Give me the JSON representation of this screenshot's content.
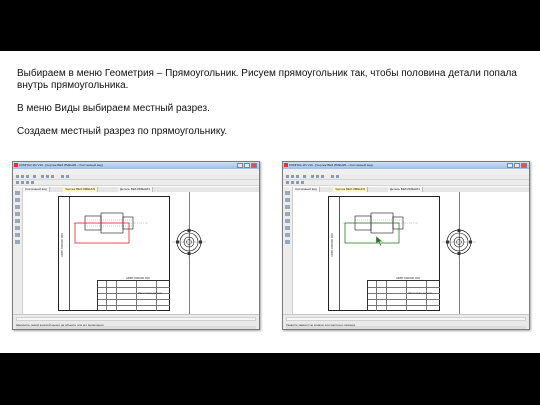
{
  "paragraphs": [
    "Выбираем в меню Геометрия – Прямоугольник. Рисуем прямоугольник так, чтобы половина детали попала внутрь прямоугольника.",
    "В меню Виды выбираем местный разрез.",
    "Создаем местный разрез по прямоугольнику."
  ],
  "screenshots": [
    {
      "window_title": "КОМПАС-3D V10 - [Чертеж БЕЗ ИМЕНИ1 ->Системный вид]",
      "menu": [
        "Файл",
        "Редактор",
        "Выделить",
        "Вид",
        "Вставка",
        "Инструменты",
        "Спецификация",
        "Сервис",
        "Окно",
        "Справка"
      ],
      "tabs": [
        "Системный вид",
        "Чертеж БЕЗ ИМЕНИ1",
        "Деталь БЕЗ ИМЕНИ1"
      ],
      "active_tab": 1,
      "drawing_code": "АБВГ.000000.000",
      "part_name": "Заготовка детали",
      "status": "Щелкните левой кнопкой мыши на объекте для его выделения",
      "highlight_color": "#e0262e"
    },
    {
      "window_title": "КОМПАС-3D V10 - [Чертеж БЕЗ ИМЕНИ1 ->Системный вид]",
      "menu": [
        "Файл",
        "Редактор",
        "Выделить",
        "Вид",
        "Вставка",
        "Инструменты",
        "Спецификация",
        "Сервис",
        "Окно",
        "Справка"
      ],
      "tabs": [
        "Системный вид",
        "Чертеж БЕЗ ИМЕНИ1",
        "Деталь БЕЗ ИМЕНИ1"
      ],
      "active_tab": 1,
      "drawing_code": "АБВГ.000000.000",
      "part_name": "Заготовка детали",
      "status": "Укажите замкнутую кривую для местного разреза",
      "highlight_color": "#2a7a2a"
    }
  ],
  "icons": {
    "window_buttons": [
      "minimize-icon",
      "maximize-icon",
      "close-icon"
    ],
    "cursor": "arrow-cursor-icon"
  }
}
